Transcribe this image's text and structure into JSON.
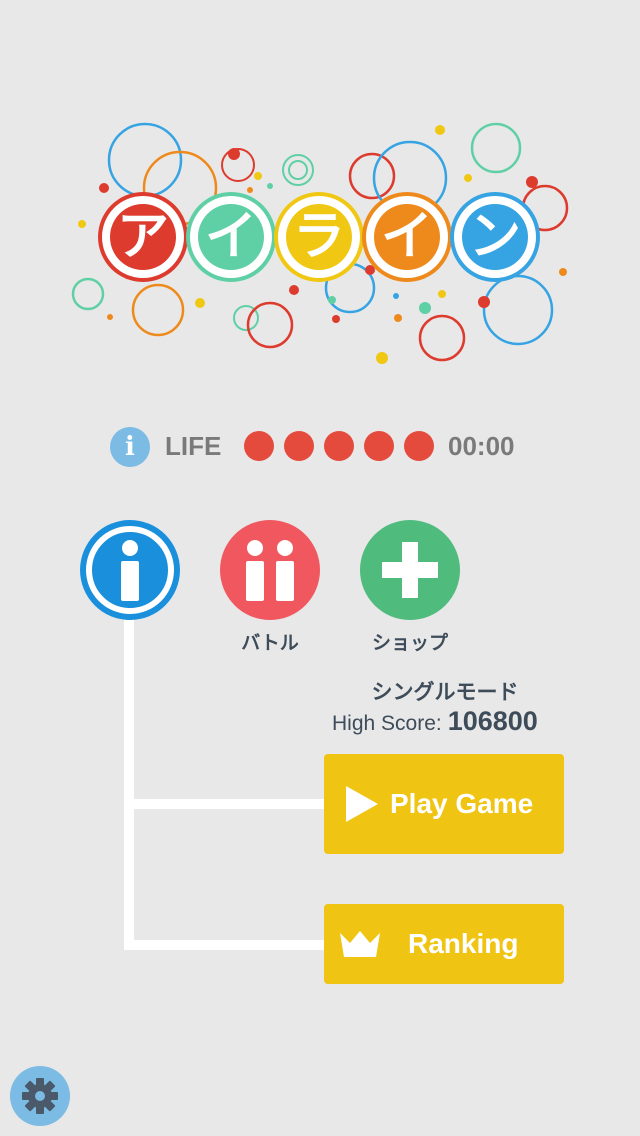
{
  "logo": {
    "characters": [
      "ア",
      "イ",
      "ラ",
      "イ",
      "ン"
    ],
    "colors": [
      "#dd3b2e",
      "#5fd0a5",
      "#f0c813",
      "#ee8a1c",
      "#36a3e3"
    ]
  },
  "life_bar": {
    "label": "LIFE",
    "lives": 5,
    "timer": "00:00",
    "info_icon": "i",
    "dot_color": "#e54b3c"
  },
  "modes": {
    "single": {
      "icon": "i",
      "label": ""
    },
    "battle": {
      "label": "バトル",
      "icon": "ii"
    },
    "shop": {
      "label": "ショップ",
      "icon": "+"
    }
  },
  "mode_info": {
    "title": "シングルモード",
    "high_score_label": "High Score:",
    "high_score_value": "106800"
  },
  "actions": {
    "play_label": "Play Game",
    "ranking_label": "Ranking",
    "button_color": "#f0c413"
  },
  "settings": {
    "icon": "gear-icon"
  }
}
